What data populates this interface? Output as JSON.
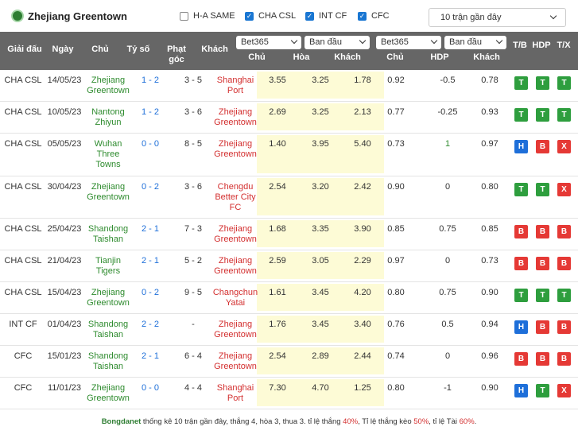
{
  "header": {
    "team": "Zhejiang Greentown",
    "filters": [
      {
        "label": "H-A SAME",
        "checked": false
      },
      {
        "label": "CHA CSL",
        "checked": true
      },
      {
        "label": "INT CF",
        "checked": true
      },
      {
        "label": "CFC",
        "checked": true
      }
    ],
    "recent_select": "10 trận gần đây"
  },
  "columns": {
    "league": "Giải đấu",
    "date": "Ngày",
    "home": "Chủ",
    "score": "Tỷ số",
    "corners_line1": "Phạt",
    "corners_line2": "góc",
    "away": "Khách",
    "bookmaker1": "Bet365",
    "type1": "Ban đầu",
    "bookmaker2": "Bet365",
    "type2": "Ban đầu",
    "o_home": "Chủ",
    "o_draw": "Hòa",
    "o_away": "Khách",
    "h_home": "Chủ",
    "h_hdp": "HDP",
    "h_away": "Khách",
    "tb": "T/B",
    "hdp": "HDP",
    "tx": "T/X"
  },
  "rows": [
    {
      "league": "CHA CSL",
      "date": "14/05/23",
      "home": [
        "Zhejiang",
        "Greentown"
      ],
      "home_c": "green",
      "score": "1 - 2",
      "score_c": "blue",
      "corners": "3 - 5",
      "away": [
        "Shanghai",
        "Port"
      ],
      "away_c": "red",
      "o1": "3.55",
      "o2": "3.25",
      "o3": "1.78",
      "h1": "0.92",
      "h2": "-0.5",
      "h3": "0.78",
      "r": [
        "T",
        "T",
        "T"
      ]
    },
    {
      "league": "CHA CSL",
      "date": "10/05/23",
      "home": [
        "Nantong",
        "Zhiyun"
      ],
      "home_c": "green",
      "score": "1 - 2",
      "score_c": "blue",
      "corners": "3 - 6",
      "away": [
        "Zhejiang",
        "Greentown"
      ],
      "away_c": "red",
      "o1": "2.69",
      "o2": "3.25",
      "o3": "2.13",
      "h1": "0.77",
      "h2": "-0.25",
      "h3": "0.93",
      "r": [
        "T",
        "T",
        "T"
      ]
    },
    {
      "league": "CHA CSL",
      "date": "05/05/23",
      "home": [
        "Wuhan",
        "Three",
        "Towns"
      ],
      "home_c": "green",
      "score": "0 - 0",
      "score_c": "blue",
      "corners": "8 - 5",
      "away": [
        "Zhejiang",
        "Greentown"
      ],
      "away_c": "red",
      "o1": "1.40",
      "o2": "3.95",
      "o3": "5.40",
      "h1": "0.73",
      "h2": "1",
      "h2_c": "green",
      "h3": "0.97",
      "r": [
        "H",
        "B",
        "X"
      ]
    },
    {
      "league": "CHA CSL",
      "date": "30/04/23",
      "home": [
        "Zhejiang",
        "Greentown"
      ],
      "home_c": "green",
      "score": "0 - 2",
      "score_c": "blue",
      "corners": "3 - 6",
      "away": [
        "Chengdu",
        "Better City",
        "FC"
      ],
      "away_c": "red",
      "o1": "2.54",
      "o2": "3.20",
      "o3": "2.42",
      "h1": "0.90",
      "h2": "0",
      "h3": "0.80",
      "r": [
        "T",
        "T",
        "X"
      ]
    },
    {
      "league": "CHA CSL",
      "date": "25/04/23",
      "home": [
        "Shandong",
        "Taishan"
      ],
      "home_c": "green",
      "score": "2 - 1",
      "score_c": "blue",
      "corners": "7 - 3",
      "away": [
        "Zhejiang",
        "Greentown"
      ],
      "away_c": "red",
      "o1": "1.68",
      "o2": "3.35",
      "o3": "3.90",
      "h1": "0.85",
      "h2": "0.75",
      "h3": "0.85",
      "r": [
        "B",
        "B",
        "B"
      ]
    },
    {
      "league": "CHA CSL",
      "date": "21/04/23",
      "home": [
        "Tianjin",
        "Tigers"
      ],
      "home_c": "green",
      "score": "2 - 1",
      "score_c": "blue",
      "corners": "5 - 2",
      "away": [
        "Zhejiang",
        "Greentown"
      ],
      "away_c": "red",
      "o1": "2.59",
      "o2": "3.05",
      "o3": "2.29",
      "h1": "0.97",
      "h2": "0",
      "h3": "0.73",
      "r": [
        "B",
        "B",
        "B"
      ]
    },
    {
      "league": "CHA CSL",
      "date": "15/04/23",
      "home": [
        "Zhejiang",
        "Greentown"
      ],
      "home_c": "green",
      "score": "0 - 2",
      "score_c": "blue",
      "corners": "9 - 5",
      "away": [
        "Changchun",
        "Yatai"
      ],
      "away_c": "red",
      "o1": "1.61",
      "o2": "3.45",
      "o3": "4.20",
      "h1": "0.80",
      "h2": "0.75",
      "h3": "0.90",
      "r": [
        "T",
        "T",
        "T"
      ]
    },
    {
      "league": "INT CF",
      "date": "01/04/23",
      "home": [
        "Shandong",
        "Taishan"
      ],
      "home_c": "green",
      "score": "2 - 2",
      "score_c": "blue",
      "corners": "-",
      "away": [
        "Zhejiang",
        "Greentown"
      ],
      "away_c": "red",
      "o1": "1.76",
      "o2": "3.45",
      "o3": "3.40",
      "h1": "0.76",
      "h2": "0.5",
      "h3": "0.94",
      "r": [
        "H",
        "B",
        "B"
      ]
    },
    {
      "league": "CFC",
      "date": "15/01/23",
      "home": [
        "Shandong",
        "Taishan"
      ],
      "home_c": "green",
      "score": "2 - 1",
      "score_c": "blue",
      "corners": "6 - 4",
      "away": [
        "Zhejiang",
        "Greentown"
      ],
      "away_c": "red",
      "o1": "2.54",
      "o2": "2.89",
      "o3": "2.44",
      "h1": "0.74",
      "h2": "0",
      "h3": "0.96",
      "r": [
        "B",
        "B",
        "B"
      ]
    },
    {
      "league": "CFC",
      "date": "11/01/23",
      "home": [
        "Zhejiang",
        "Greentown"
      ],
      "home_c": "green",
      "score": "0 - 0",
      "score_c": "blue",
      "corners": "4 - 4",
      "away": [
        "Shanghai",
        "Port"
      ],
      "away_c": "red",
      "o1": "7.30",
      "o2": "4.70",
      "o3": "1.25",
      "h1": "0.80",
      "h2": "-1",
      "h3": "0.90",
      "r": [
        "H",
        "T",
        "X"
      ]
    }
  ],
  "footer": {
    "brand": "Bongdanet",
    "text1": " thống kê 10 trận gần đây, thắng 4, hòa 3, thua 3. tỉ lệ thắng ",
    "win_rate": "40%",
    "text2": ", Tỉ lệ thắng kèo ",
    "hdp_rate": "50%",
    "text3": ", tỉ lệ Tài ",
    "over_rate": "60%",
    "text4": "."
  },
  "colors": {
    "header_bg": "#666666",
    "odds_bg": "#fdfbd6",
    "win": "#2e9e3e",
    "lose": "#e53935",
    "draw": "#1e6fd9"
  }
}
